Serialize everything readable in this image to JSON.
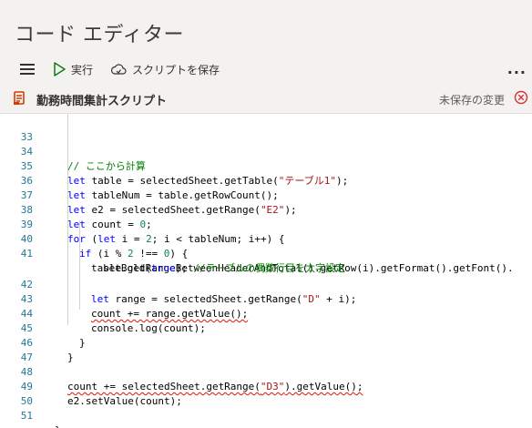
{
  "app": {
    "title": "コード エディター"
  },
  "toolbar": {
    "run_label": "実行",
    "save_label": "スクリプトを保存",
    "more_label": "..."
  },
  "script": {
    "name": "勤務時間集計スクリプト",
    "status": "未保存の変更"
  },
  "code_lines": [
    {
      "n": "33"
    },
    {
      "n": "34",
      "comment": "// ここから計算"
    },
    {
      "n": "35",
      "kw": "let",
      "rest": " table = selectedSheet.getTable(",
      "str": "\"テーブル1\"",
      "end": ");"
    },
    {
      "n": "36",
      "kw": "let",
      "rest": " tableNum = table.getRowCount();"
    },
    {
      "n": "37",
      "kw": "let",
      "rest": " e2 = selectedSheet.getRange(",
      "str": "\"E2\"",
      "end": ");"
    },
    {
      "n": "38",
      "kw": "let",
      "rest": " count = ",
      "num": "0",
      "end": ";"
    },
    {
      "n": "39",
      "kw": "for",
      "rest": " (",
      "kw2": "let",
      "rest2": " i = ",
      "num": "2",
      "end": "; i < tableNum; i++) {"
    },
    {
      "n": "40",
      "kw": "if",
      "rest": " (i % ",
      "num": "2",
      "rest2": " !== ",
      "num2": "0",
      "end": ") {"
    },
    {
      "n": "41",
      "rest": "table.getRangeBetweenHeaderAndTotal().getRow(i).getFormat().getFont()."
    },
    {
      "n": "",
      "rest": "setBold(",
      "kw": "true",
      "end": "); ",
      "comment": "//テーブルの偶数行目を太字設定"
    },
    {
      "n": "42",
      "kw": "let",
      "rest": " range = selectedSheet.getRange(",
      "str": "\"D\"",
      "end": " + i);"
    },
    {
      "n": "43",
      "rest": "count += range.getValue();"
    },
    {
      "n": "44",
      "rest": "console.log(count);"
    },
    {
      "n": "45",
      "rest": "}"
    },
    {
      "n": "46",
      "rest": "}"
    },
    {
      "n": "47"
    },
    {
      "n": "48",
      "rest": "count += selectedSheet.getRange(",
      "str": "\"D3\"",
      "end": ").getValue();"
    },
    {
      "n": "49",
      "rest": "e2.setValue(count);"
    },
    {
      "n": "50"
    },
    {
      "n": "51",
      "rest": "}"
    }
  ],
  "colors": {
    "keyword": "#0000ff",
    "string": "#a31515",
    "number": "#098658",
    "comment": "#008000",
    "line_number": "#237893",
    "run_icon": "#107c10",
    "script_icon": "#d83b01",
    "error": "#d13438"
  },
  "icons": [
    "hamburger-icon",
    "play-icon",
    "cloud-save-icon",
    "more-icon",
    "script-icon",
    "close-circle-icon"
  ]
}
